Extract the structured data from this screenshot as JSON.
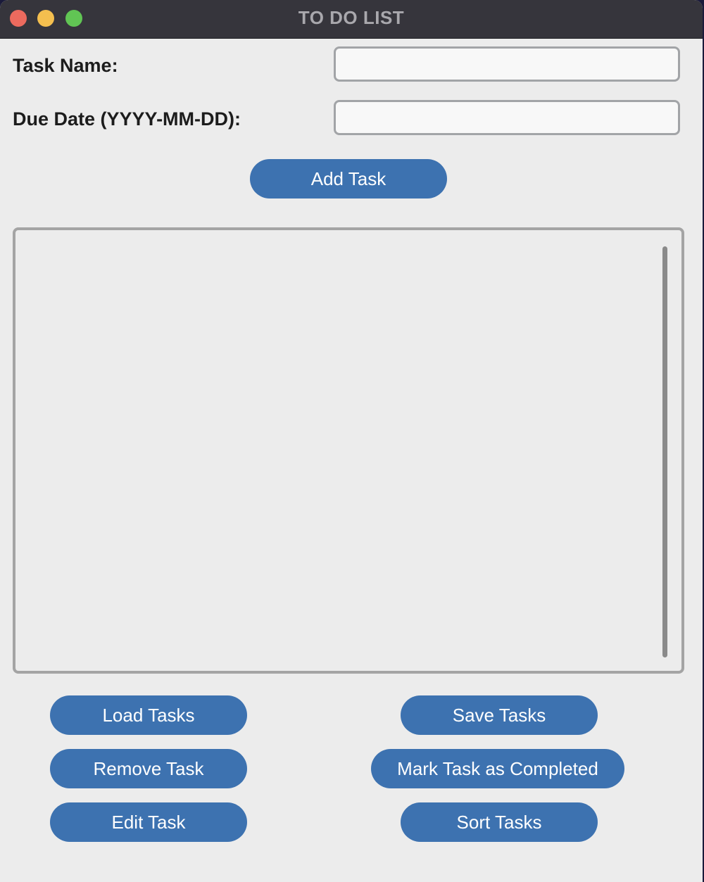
{
  "window": {
    "title": "TO DO LIST"
  },
  "form": {
    "task_name_label": "Task Name:",
    "task_name_value": "",
    "due_date_label": "Due Date (YYYY-MM-DD):",
    "due_date_value": "",
    "add_task_label": "Add Task"
  },
  "task_list": {
    "items": []
  },
  "actions": {
    "load_tasks": "Load Tasks",
    "save_tasks": "Save Tasks",
    "remove_task": "Remove Task",
    "mark_completed": "Mark Task as Completed",
    "edit_task": "Edit Task",
    "sort_tasks": "Sort Tasks"
  },
  "colors": {
    "button_bg": "#3d72b0",
    "titlebar_bg": "#36353c",
    "window_bg": "#ececec",
    "close": "#ec6a5e",
    "minimize": "#f4bf4f",
    "maximize": "#61c554"
  }
}
